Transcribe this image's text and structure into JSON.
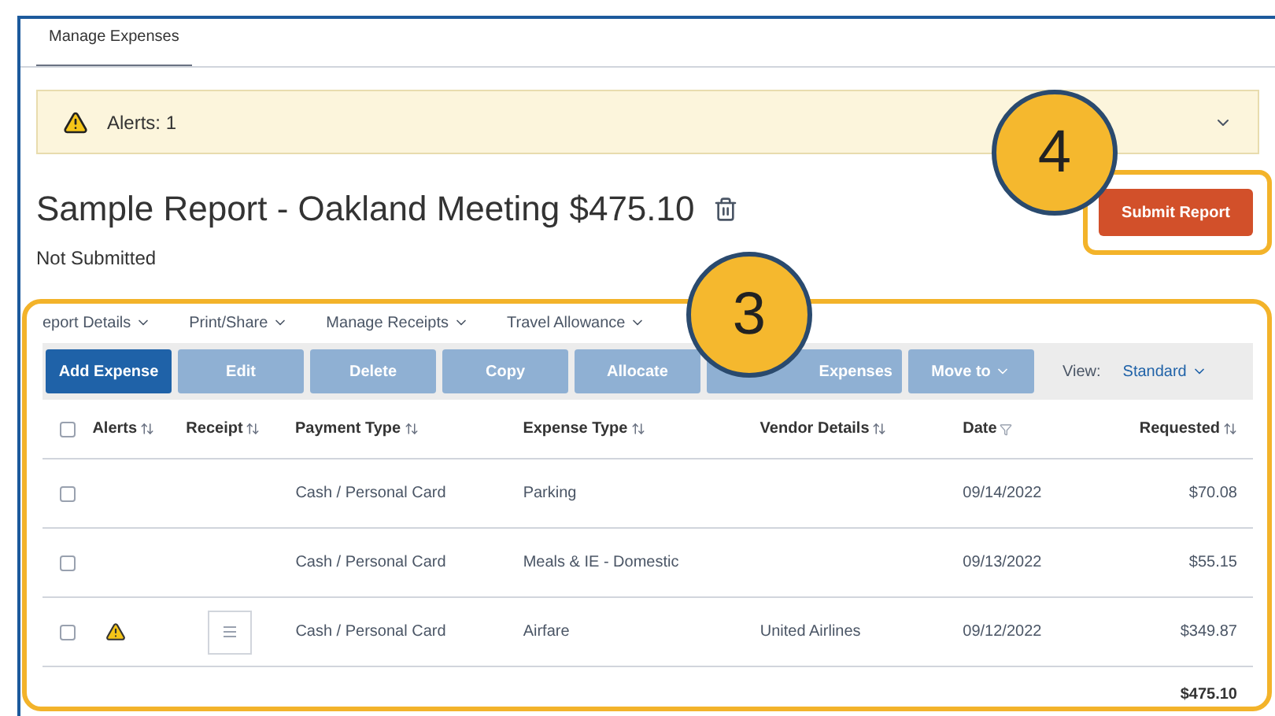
{
  "tabs": [
    {
      "label": "Manage Expenses",
      "selected": true
    }
  ],
  "alert_bar": {
    "text": "Alerts: 1",
    "expanded": false
  },
  "report": {
    "title": "Sample Report - Oakland Meeting $475.10",
    "status": "Not Submitted"
  },
  "submit_button": "Submit Report",
  "menus": [
    "eport Details",
    "Print/Share",
    "Manage Receipts",
    "Travel Allowance"
  ],
  "toolbar": {
    "buttons": [
      {
        "label": "Add Expense",
        "disabled": false,
        "kind": "button"
      },
      {
        "label": "Edit",
        "disabled": true,
        "kind": "button"
      },
      {
        "label": "Delete",
        "disabled": true,
        "kind": "button"
      },
      {
        "label": "Copy",
        "disabled": true,
        "kind": "button"
      },
      {
        "label": "Allocate",
        "disabled": true,
        "kind": "button"
      },
      {
        "label": "Expenses",
        "disabled": true,
        "kind": "button"
      },
      {
        "label": "Move to",
        "disabled": true,
        "kind": "dropdown"
      }
    ],
    "view_label": "View:",
    "view_value": "Standard"
  },
  "table": {
    "select_all_checked": false,
    "columns": [
      {
        "label": "Alerts",
        "kind": "sortable"
      },
      {
        "label": "Receipt",
        "kind": "sortable"
      },
      {
        "label": "Payment Type",
        "kind": "sortable"
      },
      {
        "label": "Expense Type",
        "kind": "sortable"
      },
      {
        "label": "Vendor Details",
        "kind": "sortable"
      },
      {
        "label": "Date",
        "kind": "filter"
      },
      {
        "label": "Requested",
        "kind": "sortable"
      }
    ],
    "rows": [
      {
        "checked": false,
        "alert": false,
        "receipt": false,
        "payment_type": "Cash / Personal Card",
        "expense_type": "Parking",
        "date": "09/14/2022",
        "requested": "$70.08"
      },
      {
        "checked": false,
        "alert": false,
        "receipt": false,
        "payment_type": "Cash / Personal Card",
        "expense_type": "Meals & IE - Domestic",
        "date": "09/13/2022",
        "requested": "$55.15"
      },
      {
        "checked": false,
        "alert": true,
        "receipt": true,
        "payment_type": "Cash / Personal Card",
        "expense_type": "Airfare",
        "vendor": "United Airlines",
        "date": "09/12/2022",
        "requested": "$349.87"
      }
    ],
    "total": "$475.10"
  },
  "callouts": [
    {
      "label": "4"
    },
    {
      "label": "3"
    }
  ]
}
